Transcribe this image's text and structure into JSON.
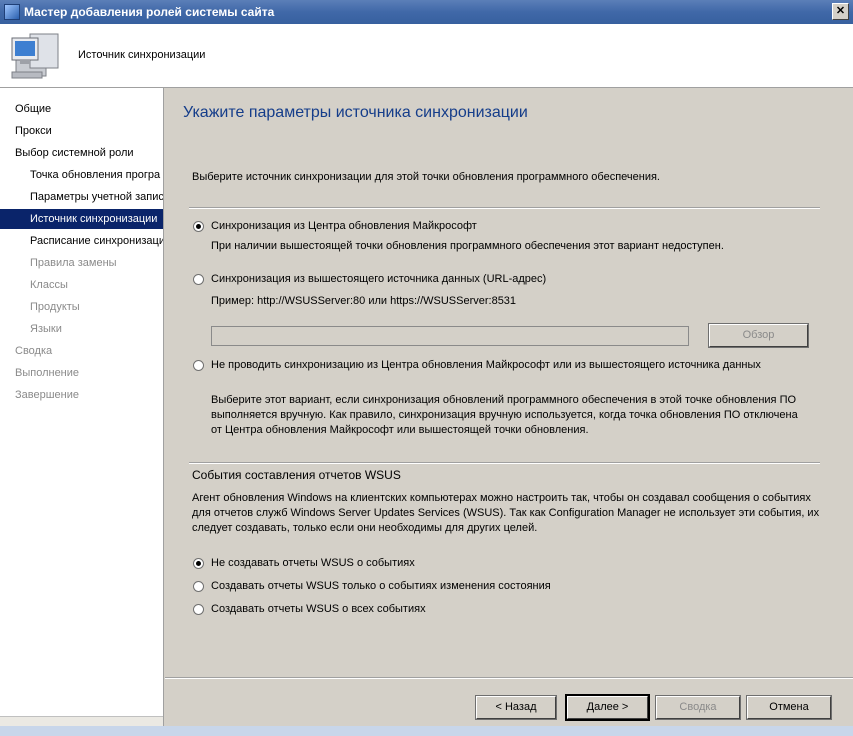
{
  "window": {
    "title": "Мастер добавления ролей системы сайта"
  },
  "header": {
    "title": "Источник синхронизации"
  },
  "sidebar": {
    "items": [
      {
        "label": "Общие",
        "level": 0,
        "state": "normal"
      },
      {
        "label": "Прокси",
        "level": 0,
        "state": "normal"
      },
      {
        "label": "Выбор системной роли",
        "level": 0,
        "state": "normal"
      },
      {
        "label": "Точка обновления програ",
        "level": 1,
        "state": "normal"
      },
      {
        "label": "Параметры учетной запис",
        "level": 1,
        "state": "normal"
      },
      {
        "label": "Источник синхронизации",
        "level": 1,
        "state": "active"
      },
      {
        "label": "Расписание синхронизаци",
        "level": 1,
        "state": "normal"
      },
      {
        "label": "Правила замены",
        "level": 1,
        "state": "dim"
      },
      {
        "label": "Классы",
        "level": 1,
        "state": "dim"
      },
      {
        "label": "Продукты",
        "level": 1,
        "state": "dim"
      },
      {
        "label": "Языки",
        "level": 1,
        "state": "dim"
      },
      {
        "label": "Сводка",
        "level": 0,
        "state": "dim"
      },
      {
        "label": "Выполнение",
        "level": 0,
        "state": "dim"
      },
      {
        "label": "Завершение",
        "level": 0,
        "state": "dim"
      }
    ]
  },
  "main": {
    "title": "Укажите параметры источника синхронизации",
    "intro": "Выберите источник синхронизации для этой точки обновления программного обеспечения.",
    "source_options": [
      {
        "label": "Синхронизация из Центра обновления Майкрософт",
        "checked": true
      },
      {
        "label": "Синхронизация из вышестоящего источника данных (URL-адрес)",
        "checked": false
      },
      {
        "label": "Не проводить синхронизацию из Центра обновления Майкрософт или из вышестоящего источника данных",
        "checked": false
      }
    ],
    "option1_note": "При наличии вышестоящей точки обновления программного обеспечения этот вариант недоступен.",
    "option2_example": "Пример: http://WSUSServer:80 или https://WSUSServer:8531",
    "url_value": "",
    "browse_label": "Обзор",
    "option3_note_lines": [
      "Выберите этот вариант, если синхронизация обновлений программного обеспечения в этой точке обновления ПО",
      "выполняется вручную. Как правило, синхронизация вручную используется, когда точка обновления ПО отключена",
      "от Центра обновления Майкрософт или вышестоящей точки обновления."
    ],
    "reporting_title": "События составления отчетов WSUS",
    "reporting_desc_lines": [
      "Агент обновления Windows на клиентских компьютерах можно настроить так, чтобы он создавал сообщения о событиях",
      "для отчетов служб Windows Server Updates Services (WSUS). Так как Configuration Manager не использует эти события, их",
      "следует создавать, только если они необходимы для других целей."
    ],
    "reporting_options": [
      {
        "label": "Не создавать отчеты WSUS о событиях",
        "checked": true
      },
      {
        "label": "Создавать отчеты WSUS только о событиях изменения состояния",
        "checked": false
      },
      {
        "label": "Создавать отчеты WSUS о всех событиях",
        "checked": false
      }
    ]
  },
  "buttons": {
    "back": "< Назад",
    "next": "Далее >",
    "summary": "Сводка",
    "cancel": "Отмена"
  }
}
